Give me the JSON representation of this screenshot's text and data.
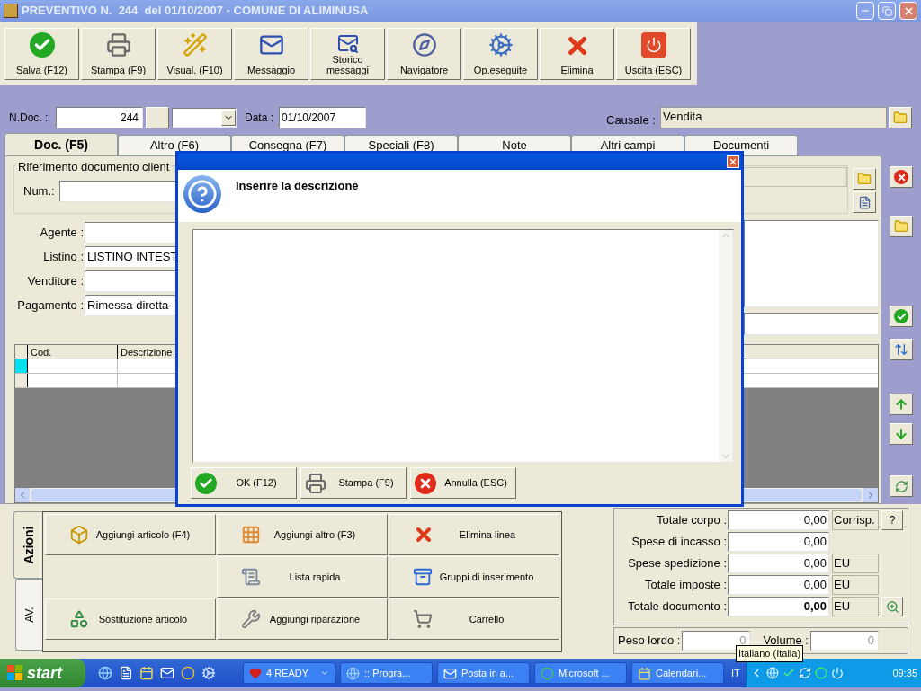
{
  "window": {
    "title": "PREVENTIVO N.  244  del 01/10/2007 - COMUNE DI ALIMINUSA"
  },
  "toolbar": [
    {
      "label": "Salva (F12)",
      "kind": "save"
    },
    {
      "label": "Stampa (F9)",
      "kind": "print"
    },
    {
      "label": "Visual. (F10)",
      "kind": "visual"
    },
    {
      "label": "Messaggio",
      "kind": "message"
    },
    {
      "label": "Storico messaggi",
      "kind": "history"
    },
    {
      "label": "Navigatore",
      "kind": "navigator"
    },
    {
      "label": "Op.eseguite",
      "kind": "operations"
    },
    {
      "label": "Elimina",
      "kind": "delete"
    },
    {
      "label": "Uscita (ESC)",
      "kind": "exit"
    }
  ],
  "header": {
    "ndoc_label": "N.Doc. :",
    "ndoc_value": "244",
    "data_label": "Data :",
    "data_value": "01/10/2007",
    "causale_label": "Causale :",
    "causale_value": "Vendita"
  },
  "tabs": [
    {
      "label": "Doc. (F5)",
      "selected": true
    },
    {
      "label": "Altro (F6)",
      "selected": false
    },
    {
      "label": "Consegna (F7)",
      "selected": false
    },
    {
      "label": "Speciali (F8)",
      "selected": false
    },
    {
      "label": "Note",
      "selected": false
    },
    {
      "label": "Altri campi",
      "selected": false
    },
    {
      "label": "Documenti",
      "selected": false
    }
  ],
  "reference": {
    "legend": "Riferimento documento client",
    "num_label": "Num.:"
  },
  "fields": [
    {
      "label": "Agente :"
    },
    {
      "label": "Listino :",
      "value": "LISTINO INTEST"
    },
    {
      "label": "Venditore :"
    },
    {
      "label": "Pagamento :",
      "value": "Rimessa diretta"
    }
  ],
  "grid": {
    "columns": [
      "Cod.",
      "Descrizione"
    ],
    "rows": [
      {
        "selected": true
      },
      {
        "selected": false
      }
    ]
  },
  "actions": {
    "tabs": [
      {
        "label": "Azioni",
        "selected": true
      },
      {
        "label": "AV.",
        "selected": false
      }
    ],
    "rows": [
      [
        {
          "label": "Aggiungi articolo (F4)",
          "kind": "article"
        },
        {
          "label": "Aggiungi altro (F3)",
          "kind": "other"
        },
        {
          "label": "Elimina linea",
          "kind": "delete"
        }
      ],
      [
        {
          "kind": "blank"
        },
        {
          "label": "Lista rapida",
          "kind": "list"
        },
        {
          "label": "Gruppi di inserimento",
          "kind": "groups"
        }
      ],
      [
        {
          "label": "Sostituzione articolo",
          "kind": "replace"
        },
        {
          "label": "Aggiungi riparazione",
          "kind": "repair"
        },
        {
          "label": "Carrello",
          "kind": "cart"
        }
      ]
    ]
  },
  "totals": [
    {
      "label": "Totale corpo :",
      "value": "0,00",
      "bold": false,
      "unit": "Corrisp.",
      "button": {
        "kind": "text",
        "label": "?"
      }
    },
    {
      "label": "Spese di incasso :",
      "value": "0,00",
      "bold": false
    },
    {
      "label": "Spese spedizione :",
      "value": "0,00",
      "bold": false,
      "unit": "EU"
    },
    {
      "label": "Totale imposte :",
      "value": "0,00",
      "bold": false,
      "unit": "EU"
    },
    {
      "label": "Totale documento :",
      "value": "0,00",
      "bold": true,
      "unit": "EU",
      "button": {
        "kind": "zoom"
      }
    }
  ],
  "weights": [
    {
      "label": "Peso lordo :",
      "value": "0",
      "disabled": true
    },
    {
      "label": "Volume :",
      "value": "0",
      "disabled": true
    }
  ],
  "dialog": {
    "message": "Inserire la descrizione",
    "buttons": [
      {
        "label": "OK (F12)",
        "kind": "ok"
      },
      {
        "label": "Stampa (F9)",
        "kind": "print"
      },
      {
        "label": "Annulla (ESC)",
        "kind": "cancel"
      }
    ]
  },
  "tooltip": "Italiano (Italia)",
  "taskbar": {
    "start": "start",
    "tasks": [
      {
        "label": "4 READY",
        "kind": "group"
      },
      {
        "label": ":: Progra...",
        "kind": "browser"
      },
      {
        "label": "Posta in a...",
        "kind": "mail"
      },
      {
        "label": "Microsoft ...",
        "kind": "app"
      },
      {
        "label": "Calendari...",
        "kind": "calendar"
      }
    ],
    "language": "IT",
    "clock": "09:35"
  }
}
